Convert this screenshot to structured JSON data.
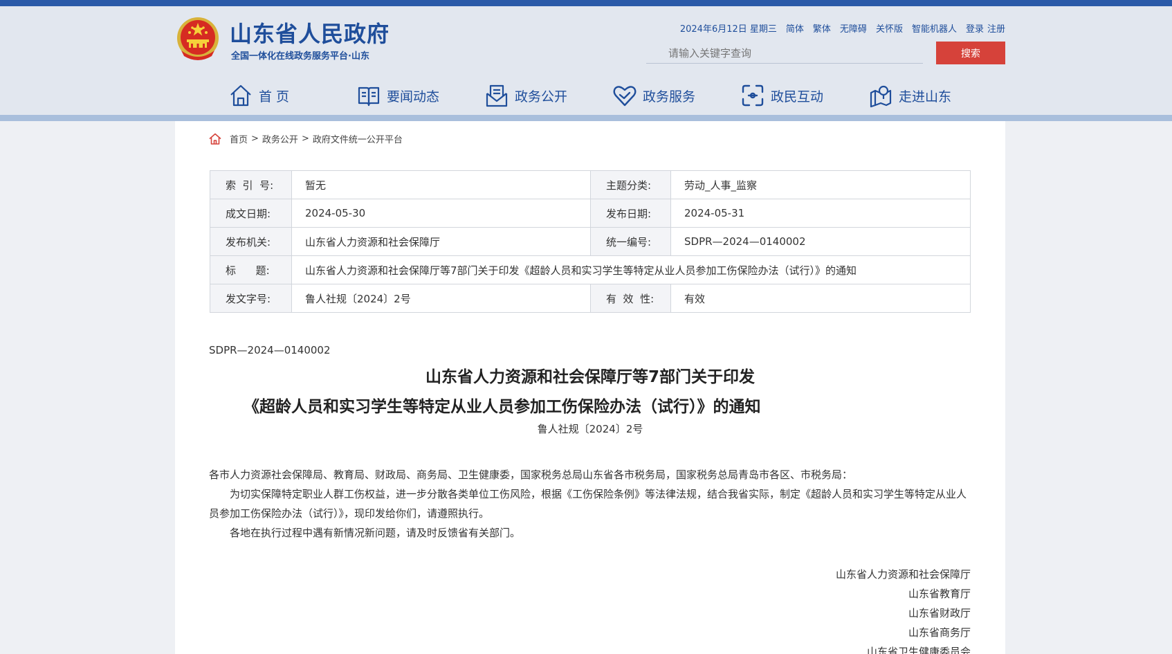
{
  "header": {
    "site_title": "山东省人民政府",
    "site_subtitle": "全国一体化在线政务服务平台·山东",
    "date": "2024年6月12日 星期三",
    "links": [
      "简体",
      "繁体",
      "无障碍",
      "关怀版",
      "智能机器人",
      "登录",
      "注册"
    ],
    "search_placeholder": "请输入关键字查询",
    "search_button": "搜索",
    "colors": {
      "brand": "#1f4e9b",
      "accent": "#d6423a",
      "header_bg": "#e2e7ef"
    }
  },
  "nav": [
    {
      "label": "首 页",
      "icon": "home-icon"
    },
    {
      "label": "要闻动态",
      "icon": "book-icon"
    },
    {
      "label": "政务公开",
      "icon": "envelope-document-icon"
    },
    {
      "label": "政务服务",
      "icon": "heart-icon"
    },
    {
      "label": "政民互动",
      "icon": "interaction-icon"
    },
    {
      "label": "走进山东",
      "icon": "map-pin-icon"
    }
  ],
  "breadcrumb": {
    "icon": "home-icon",
    "items": [
      "首页",
      "政务公开",
      "政府文件统一公开平台"
    ],
    "separator": ">"
  },
  "meta": {
    "index_label": "索  引  号:",
    "index_value": "暂无",
    "topic_label": "主题分类:",
    "topic_value": "劳动_人事_监察",
    "written_label": "成文日期:",
    "written_value": "2024-05-30",
    "published_label": "发布日期:",
    "published_value": "2024-05-31",
    "issuer_label": "发布机关:",
    "issuer_value": "山东省人力资源和社会保障厅",
    "code_label": "统一编号:",
    "code_value": "SDPR—2024—0140002",
    "title_label": "标      题:",
    "title_value": "山东省人力资源和社会保障厅等7部门关于印发《超龄人员和实习学生等特定从业人员参加工伤保险办法（试行）》的通知",
    "docno_label": "发文字号:",
    "docno_value": "鲁人社规〔2024〕2号",
    "validity_label": "有  效  性:",
    "validity_value": "有效"
  },
  "document": {
    "code": "SDPR—2024—0140002",
    "title_line1": "山东省人力资源和社会保障厅等7部门关于印发",
    "title_line2": "《超龄人员和实习学生等特定从业人员参加工伤保险办法（试行）》的通知",
    "ref_no": "鲁人社规〔2024〕2号",
    "addressee": "各市人力资源社会保障局、教育局、财政局、商务局、卫生健康委，国家税务总局山东省各市税务局，国家税务总局青岛市各区、市税务局：",
    "para1": "为切实保障特定职业人群工伤权益，进一步分散各类单位工伤风险，根据《工伤保险条例》等法律法规，结合我省实际，制定《超龄人员和实习学生等特定从业人员参加工伤保险办法（试行）》，现印发给你们，请遵照执行。",
    "para2": "各地在执行过程中遇有新情况新问题，请及时反馈省有关部门。",
    "signatories": [
      "山东省人力资源和社会保障厅",
      "山东省教育厅",
      "山东省财政厅",
      "山东省商务厅",
      "山东省卫生健康委员会"
    ]
  }
}
